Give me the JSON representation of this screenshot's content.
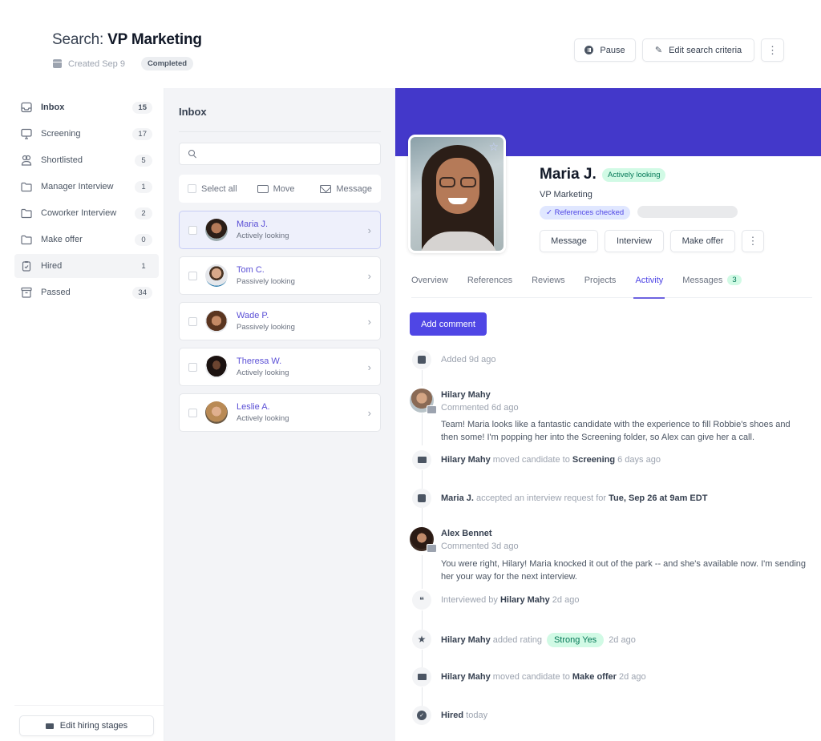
{
  "header": {
    "title_prefix": "Search: ",
    "title_main": "VP Marketing",
    "created": "Created Sep 9",
    "status": "Completed",
    "actions": {
      "pause": "Pause",
      "edit": "Edit search criteria",
      "more": "⋮"
    }
  },
  "sidebar": {
    "items": [
      {
        "label": "Inbox",
        "count": "15",
        "icon": "inbox-icon"
      },
      {
        "label": "Screening",
        "count": "17",
        "icon": "monitor-icon"
      },
      {
        "label": "Shortlisted",
        "count": "5",
        "icon": "users-icon"
      },
      {
        "label": "Manager Interview",
        "count": "1",
        "icon": "folder-icon"
      },
      {
        "label": "Coworker Interview",
        "count": "2",
        "icon": "folder-icon"
      },
      {
        "label": "Make offer",
        "count": "0",
        "icon": "folder-icon"
      },
      {
        "label": "Hired",
        "count": "1",
        "icon": "clipboard-check-icon"
      },
      {
        "label": "Passed",
        "count": "34",
        "icon": "archive-icon"
      }
    ],
    "footer_button": "Edit hiring stages"
  },
  "inbox": {
    "title": "Inbox",
    "search_placeholder": "",
    "select_all": "Select all",
    "move": "Move",
    "message": "Message",
    "candidates": [
      {
        "name": "Maria J.",
        "status": "Actively looking",
        "selected": true
      },
      {
        "name": "Tom C.",
        "status": "Passively looking",
        "selected": false
      },
      {
        "name": "Wade P.",
        "status": "Passively looking",
        "selected": false
      },
      {
        "name": "Theresa W.",
        "status": "Actively looking",
        "selected": false
      },
      {
        "name": "Leslie A.",
        "status": "Actively looking",
        "selected": false
      }
    ]
  },
  "profile": {
    "name": "Maria J.",
    "badge": "Actively looking",
    "role": "VP Marketing",
    "references_badge": "✓ References checked",
    "actions": {
      "message": "Message",
      "interview": "Interview",
      "offer": "Make offer",
      "more": "⋮"
    },
    "tabs": [
      {
        "label": "Overview"
      },
      {
        "label": "References"
      },
      {
        "label": "Reviews"
      },
      {
        "label": "Projects"
      },
      {
        "label": "Activity",
        "active": true
      },
      {
        "label": "Messages",
        "count": "3"
      }
    ],
    "add_comment": "Add comment",
    "colors": {
      "banner": "#4338ca",
      "accent": "#4f46e5",
      "success_bg": "#d1fae5",
      "success_fg": "#047857"
    }
  },
  "activity": {
    "added": "Added 9d ago",
    "c1_author": "Hilary Mahy",
    "c1_sub": "Commented 6d ago",
    "c1_body": "Team! Maria looks like a fantastic candidate with the experience to fill Robbie's shoes and then some! I'm popping her into the Screening folder, so Alex can give her a call.",
    "m1_actor": "Hilary Mahy",
    "m1_verb": " moved candidate to ",
    "m1_target": "Screening",
    "m1_time": " 6 days ago",
    "i1_actor": "Maria J.",
    "i1_verb": " accepted an interview request for ",
    "i1_target": "Tue, Sep 26 at 9am EDT",
    "c2_author": "Alex Bennet",
    "c2_sub": "Commented 3d ago",
    "c2_body": "You were right, Hilary! Maria knocked it out of the park -- and she's available now. I'm sending her your way for the next interview.",
    "iv_verb": "Interviewed by ",
    "iv_actor": "Hilary Mahy",
    "iv_time": " 2d ago",
    "r_actor": "Hilary Mahy",
    "r_verb": " added rating",
    "r_value": "Strong Yes",
    "r_time": "2d ago",
    "m2_actor": "Hilary Mahy",
    "m2_verb": " moved candidate to ",
    "m2_target": "Make offer",
    "m2_time": " 2d ago",
    "h_label": "Hired",
    "h_time": " today"
  }
}
